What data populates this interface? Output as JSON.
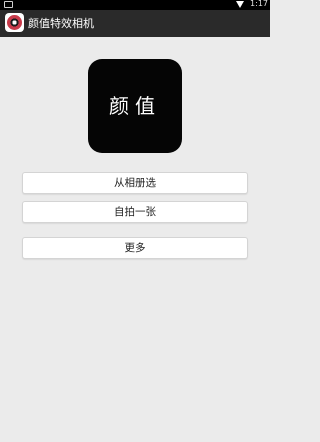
{
  "status_bar": {
    "time": "1:17",
    "icons": [
      "notification-icon",
      "wifi-icon"
    ]
  },
  "action_bar": {
    "title": "颜值特效相机",
    "icon": "app-camera-icon"
  },
  "logo": {
    "text": "颜值"
  },
  "buttons": {
    "album_label": "从相册选",
    "selfie_label": "自拍一张",
    "more_label": "更多"
  },
  "colors": {
    "background": "#ebebeb",
    "action_bar": "#2a2a2a",
    "status_bar": "#000000",
    "logo_bg": "#050505",
    "button_bg": "#ffffff"
  }
}
